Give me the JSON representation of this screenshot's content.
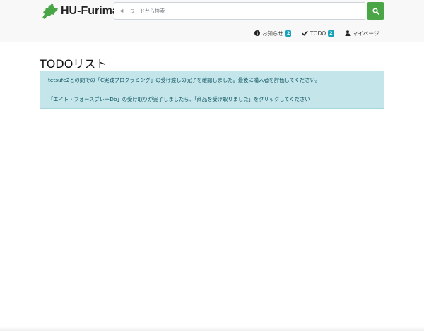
{
  "header": {
    "brand": "HU-Furima",
    "search": {
      "placeholder": "キーワードから検索",
      "value": ""
    }
  },
  "nav": {
    "notices": {
      "label": "お知らせ",
      "count": "2"
    },
    "todo": {
      "label": "TODO",
      "count": "2"
    },
    "mypage": {
      "label": "マイページ"
    }
  },
  "main": {
    "title": "TODOリスト",
    "todos": [
      {
        "text": "tetsufe2との間での「C実践プログラミング」の受け渡しの完了を確認しました。最後に購入者を評価してください。"
      },
      {
        "text": "「エイト・フォースプレーDb」の受け取りが完了しましたら、「商品を受け取りました」をクリックしてください"
      }
    ]
  },
  "colors": {
    "accent": "#4aa546",
    "badge": "#17a2b8",
    "alert_bg": "#c4e5ea",
    "alert_text": "#0c5460",
    "header_bg": "#f8f8f8"
  },
  "icons": {
    "logo": "hokkaido-map-icon",
    "search": "search-icon",
    "notices": "info-circle-icon",
    "todo": "check-icon",
    "mypage": "user-icon"
  }
}
